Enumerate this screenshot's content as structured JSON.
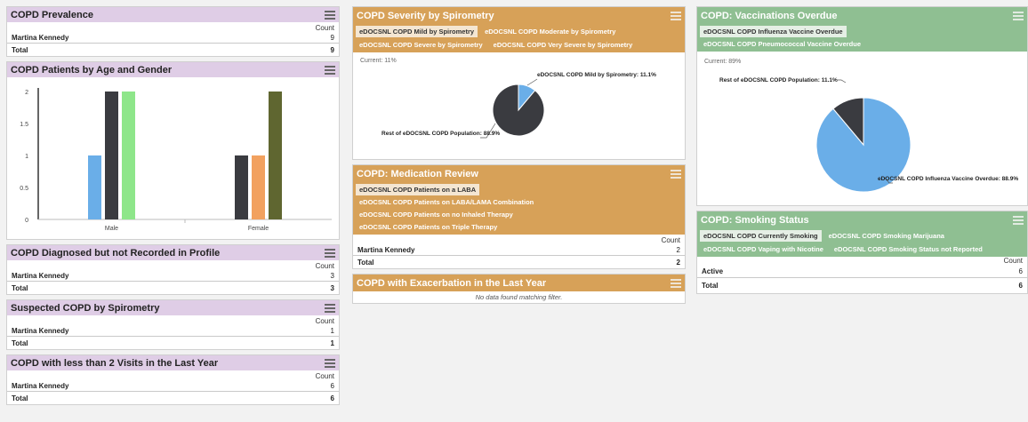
{
  "prevalence": {
    "title": "COPD Prevalence",
    "count_label": "Count",
    "rows": [
      {
        "name": "Martina Kennedy",
        "value": "9"
      }
    ],
    "total_label": "Total",
    "total_value": "9"
  },
  "age_gender": {
    "title": "COPD Patients by Age and Gender",
    "chart_data": {
      "type": "bar",
      "categories": [
        "Male",
        "Female"
      ],
      "ylim": [
        0,
        2
      ],
      "yticks": [
        "0",
        "0.5",
        "1",
        "1.5",
        "2"
      ],
      "series": [
        {
          "color": "#6aaee8",
          "values": [
            1,
            0
          ]
        },
        {
          "color": "#3a3b40",
          "values": [
            2,
            1
          ]
        },
        {
          "color": "#8ee68a",
          "values": [
            2,
            0
          ]
        },
        {
          "color": "#f2a15f",
          "values": [
            0,
            1
          ]
        },
        {
          "color": "#5f6630",
          "values": [
            0,
            2
          ]
        }
      ]
    }
  },
  "diagnosed": {
    "title": "COPD Diagnosed but not Recorded in Profile",
    "count_label": "Count",
    "rows": [
      {
        "name": "Martina Kennedy",
        "value": "3"
      }
    ],
    "total_label": "Total",
    "total_value": "3"
  },
  "suspected": {
    "title": "Suspected COPD by Spirometry",
    "count_label": "Count",
    "rows": [
      {
        "name": "Martina Kennedy",
        "value": "1"
      }
    ],
    "total_label": "Total",
    "total_value": "1"
  },
  "visits": {
    "title": "COPD with less than 2 Visits in the Last Year",
    "count_label": "Count",
    "rows": [
      {
        "name": "Martina Kennedy",
        "value": "6"
      }
    ],
    "total_label": "Total",
    "total_value": "6"
  },
  "severity": {
    "title": "COPD Severity by Spirometry",
    "tabs": [
      "eDOCSNL COPD Mild by Spirometry",
      "eDOCSNL COPD Moderate by Spirometry",
      "eDOCSNL COPD Severe by Spirometry",
      "eDOCSNL COPD Very Severe by Spirometry"
    ],
    "current": "Current: 11%",
    "chart_data": {
      "type": "pie",
      "slices": [
        {
          "label": "eDOCSNL COPD Mild by Spirometry: 11.1%",
          "value": 11.1,
          "color": "#6aaee8"
        },
        {
          "label": "Rest of eDOCSNL COPD Population: 88.9%",
          "value": 88.9,
          "color": "#3a3b40"
        }
      ]
    }
  },
  "medication": {
    "title": "COPD: Medication Review",
    "tabs": [
      "eDOCSNL COPD Patients on a LABA",
      "eDOCSNL COPD Patients on LABA/LAMA Combination",
      "eDOCSNL COPD Patients on no Inhaled Therapy",
      "eDOCSNL COPD Patients on Triple Therapy"
    ],
    "count_label": "Count",
    "rows": [
      {
        "name": "Martina Kennedy",
        "value": "2"
      }
    ],
    "total_label": "Total",
    "total_value": "2"
  },
  "exacerbation": {
    "title": "COPD with Exacerbation in the Last Year",
    "nodata": "No data found matching filter."
  },
  "vaccinations": {
    "title": "COPD: Vaccinations Overdue",
    "tabs": [
      "eDOCSNL COPD Influenza Vaccine Overdue",
      "eDOCSNL COPD Pneumococcal Vaccine Overdue"
    ],
    "current": "Current: 89%",
    "chart_data": {
      "type": "pie",
      "slices": [
        {
          "label": "eDOCSNL COPD Influenza Vaccine Overdue: 88.9%",
          "value": 88.9,
          "color": "#6aaee8"
        },
        {
          "label": "Rest of eDOCSNL COPD Population: 11.1%",
          "value": 11.1,
          "color": "#3a3b40"
        }
      ]
    }
  },
  "smoking": {
    "title": "COPD: Smoking Status",
    "tabs": [
      "eDOCSNL COPD Currently Smoking",
      "eDOCSNL COPD Smoking Marijuana",
      "eDOCSNL COPD Vaping with Nicotine",
      "eDOCSNL COPD Smoking Status not Reported"
    ],
    "count_label": "Count",
    "rows": [
      {
        "name": "Active",
        "value": "6"
      }
    ],
    "total_label": "Total",
    "total_value": "6"
  }
}
